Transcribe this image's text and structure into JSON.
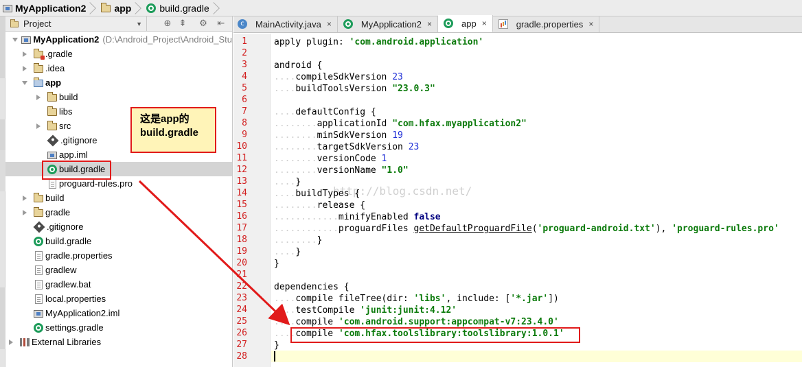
{
  "breadcrumb": {
    "items": [
      "MyApplication2",
      "app",
      "build.gradle"
    ]
  },
  "project_panel": {
    "view_selector": "Project",
    "tree": [
      {
        "label": "MyApplication2",
        "path": "(D:\\Android_Project\\Android_Stu",
        "icon": "module-icon"
      },
      {
        "label": ".gradle",
        "icon": "folder-icon"
      },
      {
        "label": ".idea",
        "icon": "folder-icon"
      },
      {
        "label": "app",
        "icon": "folder-icon"
      },
      {
        "label": "build",
        "icon": "folder-icon"
      },
      {
        "label": "libs",
        "icon": "folder-icon"
      },
      {
        "label": "src",
        "icon": "folder-icon"
      },
      {
        "label": ".gitignore",
        "icon": "git-icon"
      },
      {
        "label": "app.iml",
        "icon": "iml-file-icon"
      },
      {
        "label": "build.gradle",
        "icon": "gradle-icon"
      },
      {
        "label": "proguard-rules.pro",
        "icon": "file-icon"
      },
      {
        "label": "build",
        "icon": "folder-icon"
      },
      {
        "label": "gradle",
        "icon": "folder-icon"
      },
      {
        "label": ".gitignore",
        "icon": "git-icon"
      },
      {
        "label": "build.gradle",
        "icon": "gradle-icon"
      },
      {
        "label": "gradle.properties",
        "icon": "properties-icon"
      },
      {
        "label": "gradlew",
        "icon": "file-icon"
      },
      {
        "label": "gradlew.bat",
        "icon": "file-icon"
      },
      {
        "label": "local.properties",
        "icon": "properties-icon"
      },
      {
        "label": "MyApplication2.iml",
        "icon": "iml-file-icon"
      },
      {
        "label": "settings.gradle",
        "icon": "gradle-icon"
      },
      {
        "label": "External Libraries",
        "icon": "libraries-icon"
      }
    ]
  },
  "editor": {
    "tabs": [
      {
        "label": "MainActivity.java",
        "close": "×"
      },
      {
        "label": "MyApplication2",
        "close": "×"
      },
      {
        "label": "app",
        "close": "×"
      },
      {
        "label": "gradle.properties",
        "close": "×"
      }
    ],
    "active_tab": "app",
    "line_numbers": [
      "1",
      "2",
      "3",
      "4",
      "5",
      "6",
      "7",
      "8",
      "9",
      "10",
      "11",
      "12",
      "13",
      "14",
      "15",
      "16",
      "17",
      "18",
      "19",
      "20",
      "21",
      "22",
      "23",
      "24",
      "25",
      "26",
      "27",
      "28"
    ],
    "code": {
      "l1_a": "apply plugin: ",
      "l1_b": "'com.android.application'",
      "l3": "android {",
      "l4_a": "compileSdkVersion ",
      "l4_b": "23",
      "l5_a": "buildToolsVersion ",
      "l5_b": "\"23.0.3\"",
      "l7": "defaultConfig {",
      "l8_a": "applicationId ",
      "l8_b": "\"com.hfax.myapplication2\"",
      "l9_a": "minSdkVersion ",
      "l9_b": "19",
      "l10_a": "targetSdkVersion ",
      "l10_b": "23",
      "l11_a": "versionCode ",
      "l11_b": "1",
      "l12_a": "versionName ",
      "l12_b": "\"1.0\"",
      "l13": "}",
      "l14": "buildTypes {",
      "l15": "release {",
      "l16_a": "minifyEnabled ",
      "l16_b": "false",
      "l17_a": "proguardFiles ",
      "l17_b": "getDefaultProguardFile",
      "l17_c": "(",
      "l17_d": "'proguard-android.txt'",
      "l17_e": "), ",
      "l17_f": "'proguard-rules.pro'",
      "l18": "}",
      "l19": "}",
      "l20": "}",
      "l22": "dependencies {",
      "l23_a": "compile fileTree(dir: ",
      "l23_b": "'libs'",
      "l23_c": ", include: [",
      "l23_d": "'*.jar'",
      "l23_e": "])",
      "l24_a": "testCompile ",
      "l24_b": "'junit:junit:4.12'",
      "l25_a": "compile ",
      "l25_b": "'com.android.support:appcompat-v7:23.4.0'",
      "l26_a": "compile ",
      "l26_b": "'com.hfax.toolslibrary:toolslibrary:1.0.1'",
      "l27": "}"
    },
    "watermark": "http://blog.csdn.net/"
  },
  "annotation": {
    "callout_line1": "这是app的",
    "callout_line2": "build.gradle",
    "color": "#e11a1a"
  },
  "colors": {
    "string": "#0b7a0b",
    "number": "#1f2fd6",
    "keyword": "#000080",
    "line_number": "#d21e1e",
    "gradle": "#1d9c5a"
  }
}
